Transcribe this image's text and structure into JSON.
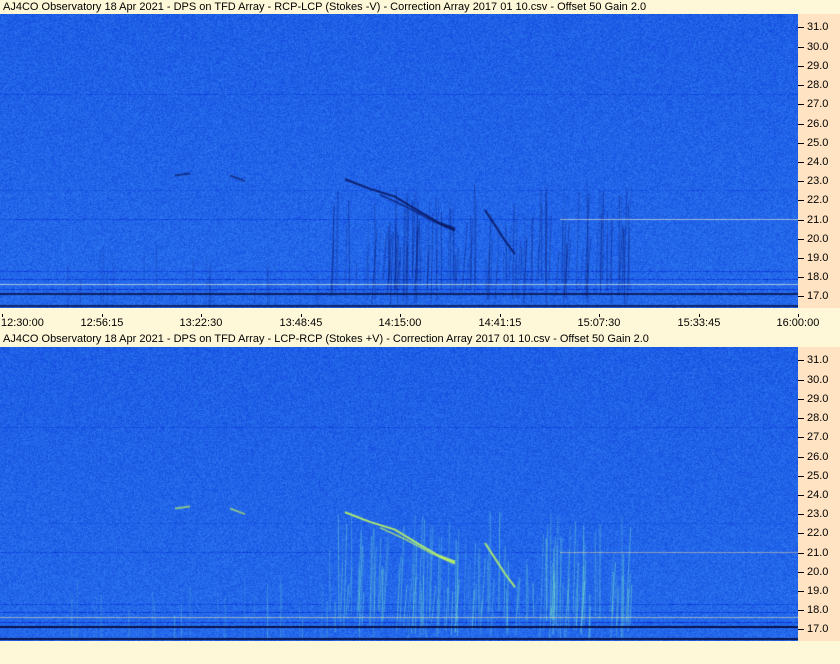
{
  "panels": [
    {
      "title": "AJ4CO Observatory 18 Apr 2021  -  DPS on TFD Array  -  RCP-LCP (Stokes -V)  -  Correction Array 2017 01 10.csv  -  Offset 50  Gain 2.0",
      "polarity": "negative"
    },
    {
      "title": "AJ4CO Observatory 18 Apr 2021  -  DPS on TFD Array  -  LCP-RCP (Stokes +V)  -  Correction Array 2017 01 10.csv  -  Offset 50  Gain 2.0",
      "polarity": "positive"
    }
  ],
  "chart_data": {
    "type": "heatmap",
    "x_ticks": [
      "12:30:00",
      "12:56:15",
      "13:22:30",
      "13:48:45",
      "14:15:00",
      "14:41:15",
      "15:07:30",
      "15:33:45",
      "16:00:00"
    ],
    "y_ticks": [
      "31.0",
      "30.0",
      "29.0",
      "28.0",
      "27.0",
      "26.0",
      "25.0",
      "24.0",
      "23.0",
      "22.0",
      "21.0",
      "20.0",
      "19.0",
      "18.0",
      "17.0"
    ],
    "ylim": [
      16.4,
      31.7
    ],
    "colors": {
      "background": "#1d5ee6",
      "low": "#0a1a6e",
      "high": "#d8ff60",
      "axis_panel": "#ffe3c2",
      "window": "#fff8d8"
    }
  }
}
